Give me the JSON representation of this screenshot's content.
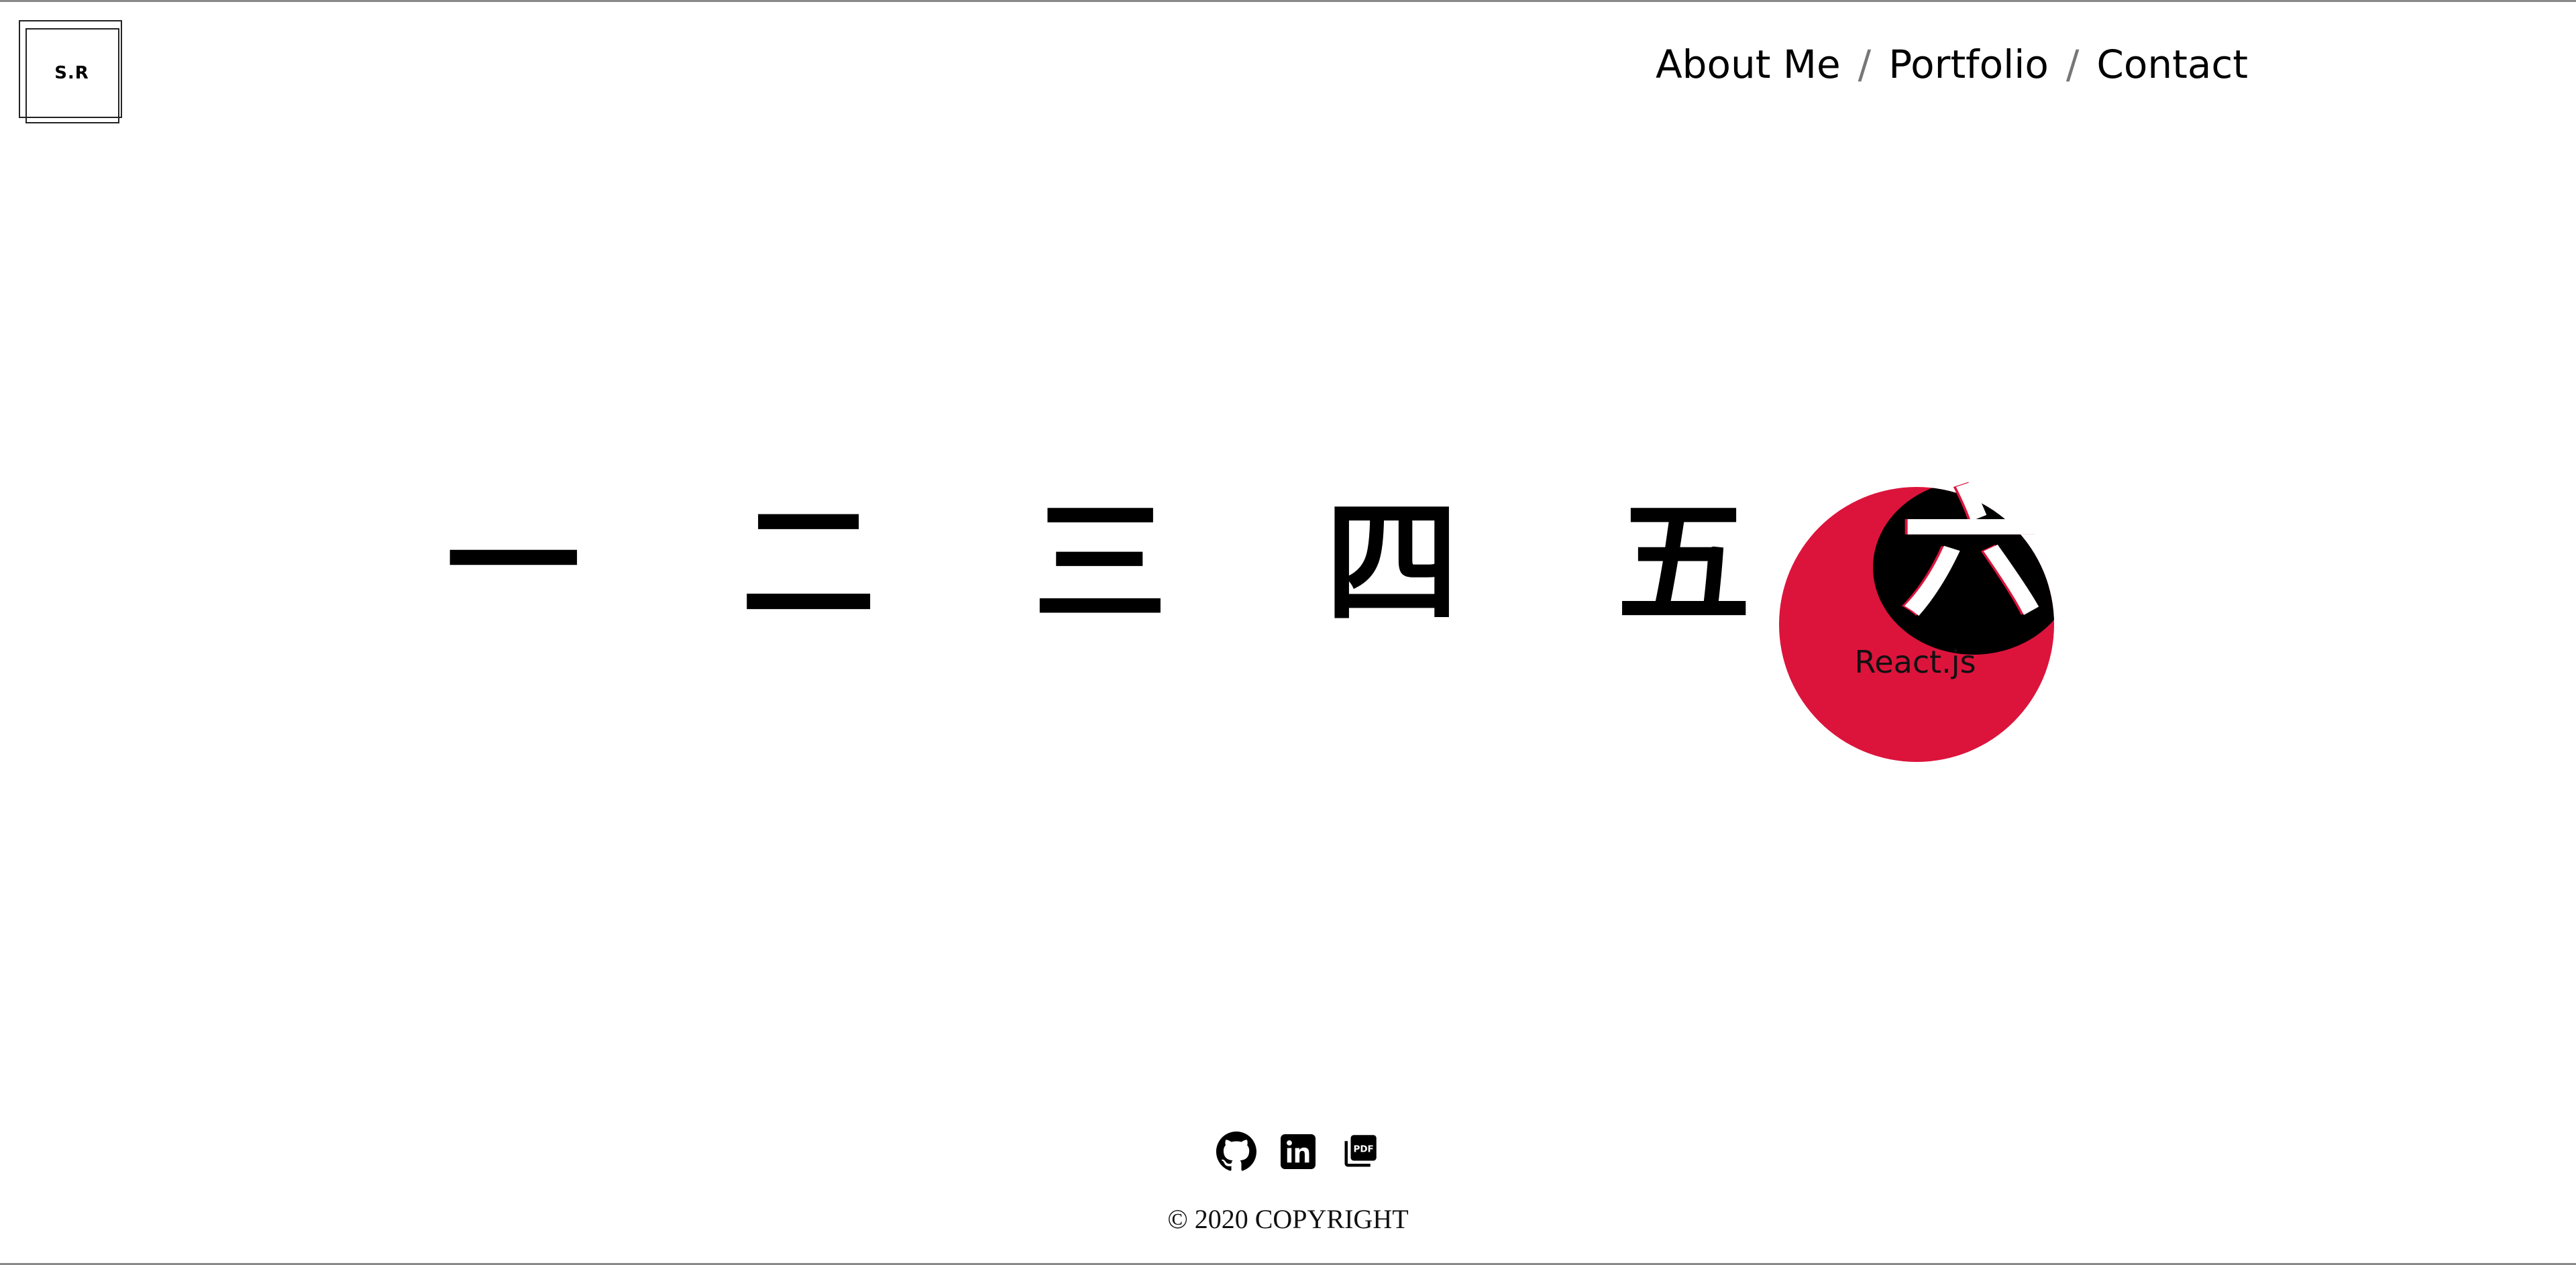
{
  "logo": {
    "text": "S.R"
  },
  "nav": {
    "items": [
      {
        "label": "About Me"
      },
      {
        "label": "Portfolio"
      },
      {
        "label": "Contact"
      }
    ],
    "separator": "/"
  },
  "kanji": {
    "items": [
      "一",
      "二",
      "三",
      "四",
      "五",
      "六"
    ],
    "active_index": 5,
    "active_label": "React.js"
  },
  "colors": {
    "accent": "#dc143c",
    "text": "#000000",
    "background": "#ffffff"
  },
  "footer": {
    "icons": [
      "github-icon",
      "linkedin-icon",
      "pdf-icon"
    ],
    "copyright": "© 2020 COPYRIGHT"
  }
}
